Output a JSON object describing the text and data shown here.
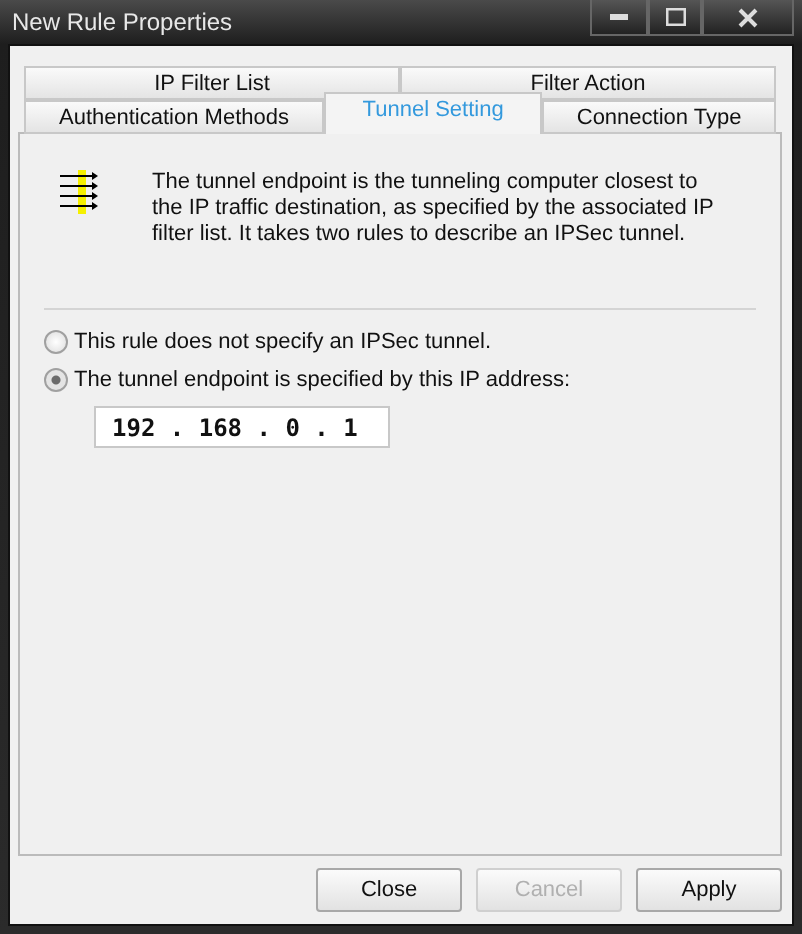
{
  "window": {
    "title": "New Rule Properties"
  },
  "tab_rows": [
    [
      {
        "label": "IP Filter List",
        "selected": false
      },
      {
        "label": "Filter Action",
        "selected": false
      }
    ],
    [
      {
        "label": "Authentication Methods",
        "selected": false
      },
      {
        "label": "Tunnel Setting",
        "selected": true
      },
      {
        "label": "Connection Type",
        "selected": false
      }
    ]
  ],
  "description": "The tunnel endpoint is the tunneling computer closest to the IP traffic destination, as specified by the associated IP filter list. It takes two rules to describe an IPSec tunnel.",
  "options": [
    {
      "label": "This rule does not specify an IPSec tunnel.",
      "selected": false
    },
    {
      "label": "The tunnel endpoint is specified by this IP address:",
      "selected": true
    }
  ],
  "ip_address": {
    "value": "192 . 168 . 0 . 1"
  },
  "buttons": [
    {
      "label": "Close",
      "disabled": false
    },
    {
      "label": "Cancel",
      "disabled": true
    },
    {
      "label": "Apply",
      "disabled": false
    }
  ]
}
